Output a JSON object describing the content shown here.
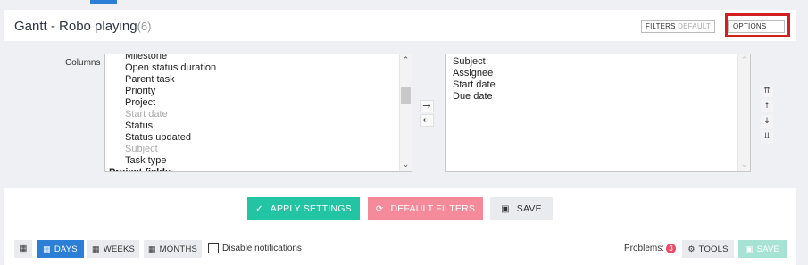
{
  "header": {
    "title": "Gantt - Robo playing",
    "count": "(6)",
    "filters_label": "FILTERS",
    "filters_sub": "DEFAULT",
    "options_label": "OPTIONS"
  },
  "columns": {
    "label": "Columns",
    "available": [
      {
        "text": "Milestone",
        "disabled": false,
        "partial": false
      },
      {
        "text": "Open status duration",
        "disabled": false,
        "partial": false
      },
      {
        "text": "Parent task",
        "disabled": false,
        "partial": false
      },
      {
        "text": "Priority",
        "disabled": false,
        "partial": false
      },
      {
        "text": "Project",
        "disabled": false,
        "partial": false
      },
      {
        "text": "Start date",
        "disabled": true,
        "partial": false
      },
      {
        "text": "Status",
        "disabled": false,
        "partial": false
      },
      {
        "text": "Status updated",
        "disabled": false,
        "partial": false
      },
      {
        "text": "Subject",
        "disabled": true,
        "partial": false
      },
      {
        "text": "Task type",
        "disabled": false,
        "partial": false
      },
      {
        "text": "Project fields",
        "disabled": false,
        "partial": true
      }
    ],
    "selected": [
      "Subject",
      "Assignee",
      "Start date",
      "Due date"
    ],
    "move_right": "→",
    "move_left": "←",
    "order_buttons": [
      "⇈",
      "↑",
      "↓",
      "⇊"
    ]
  },
  "actions": {
    "apply_label": "APPLY SETTINGS",
    "default_label": "DEFAULT FILTERS",
    "save_label": "SAVE"
  },
  "toolbar": {
    "days_label": "DAYS",
    "weeks_label": "WEEKS",
    "months_label": "MONTHS",
    "notifications_label": "Disable notifications",
    "problems_label": "Problems:",
    "problems_count": "3",
    "tools_label": "TOOLS",
    "save_label": "SAVE"
  },
  "colors": {
    "primary": "#2b7fd6",
    "apply": "#23c4a4",
    "default_filters": "#f48a9a",
    "highlight": "#d21f1f",
    "problems_badge": "#ef4d67"
  },
  "icons": {
    "apply": "check-icon",
    "default_filters": "reset-icon",
    "save": "floppy-icon",
    "calendar": "calendar-icon",
    "tools": "gear-icon"
  }
}
